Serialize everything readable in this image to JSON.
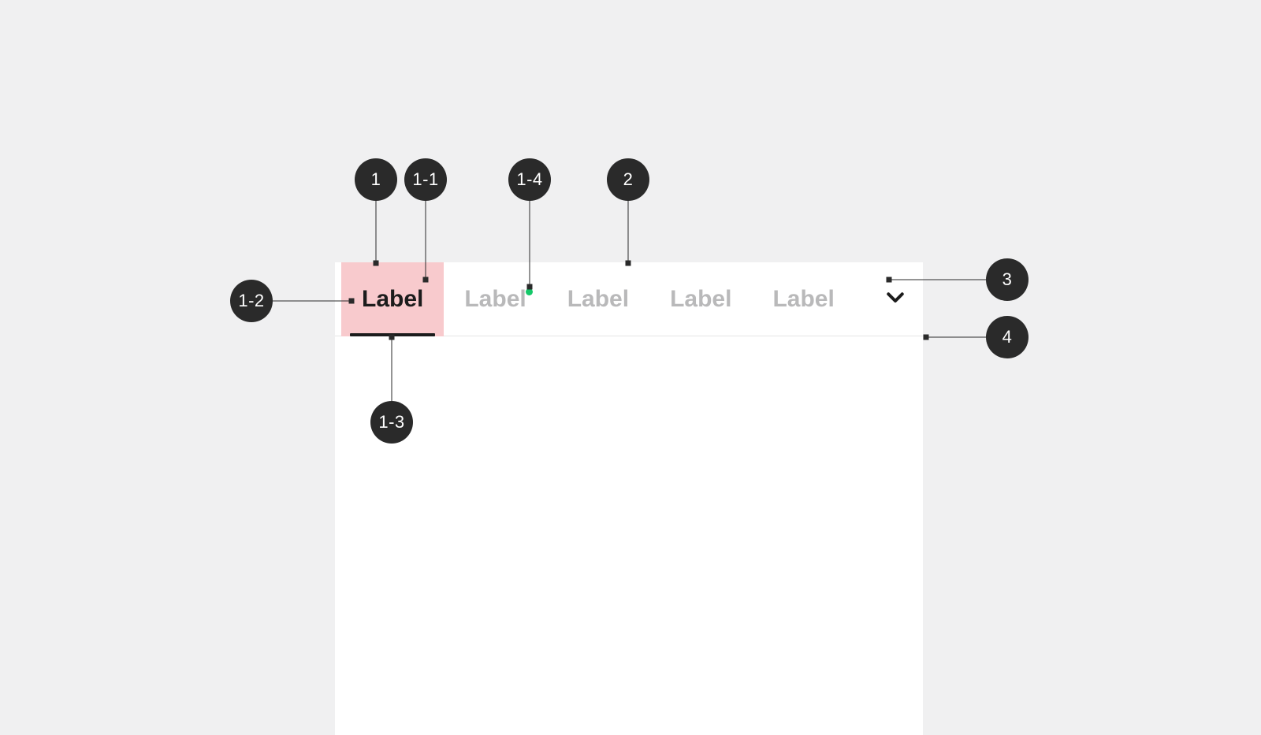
{
  "tabs": [
    {
      "label": "Label",
      "active": true,
      "badge": false
    },
    {
      "label": "Label",
      "active": false,
      "badge": true
    },
    {
      "label": "Label",
      "active": false,
      "badge": false
    },
    {
      "label": "Label",
      "active": false,
      "badge": false
    },
    {
      "label": "Label",
      "active": false,
      "badge": false
    }
  ],
  "annotations": {
    "a1": "1",
    "a1_1": "1-1",
    "a1_2": "1-2",
    "a1_3": "1-3",
    "a1_4": "1-4",
    "a2": "2",
    "a3": "3",
    "a4": "4"
  },
  "colors": {
    "active_tab_bg": "#f8cacd",
    "badge": "#15c869",
    "bubble": "#2a2a2a",
    "card_bg": "#ffffff",
    "page_bg": "#f0f0f1",
    "inactive_text": "#b9b9ba"
  }
}
